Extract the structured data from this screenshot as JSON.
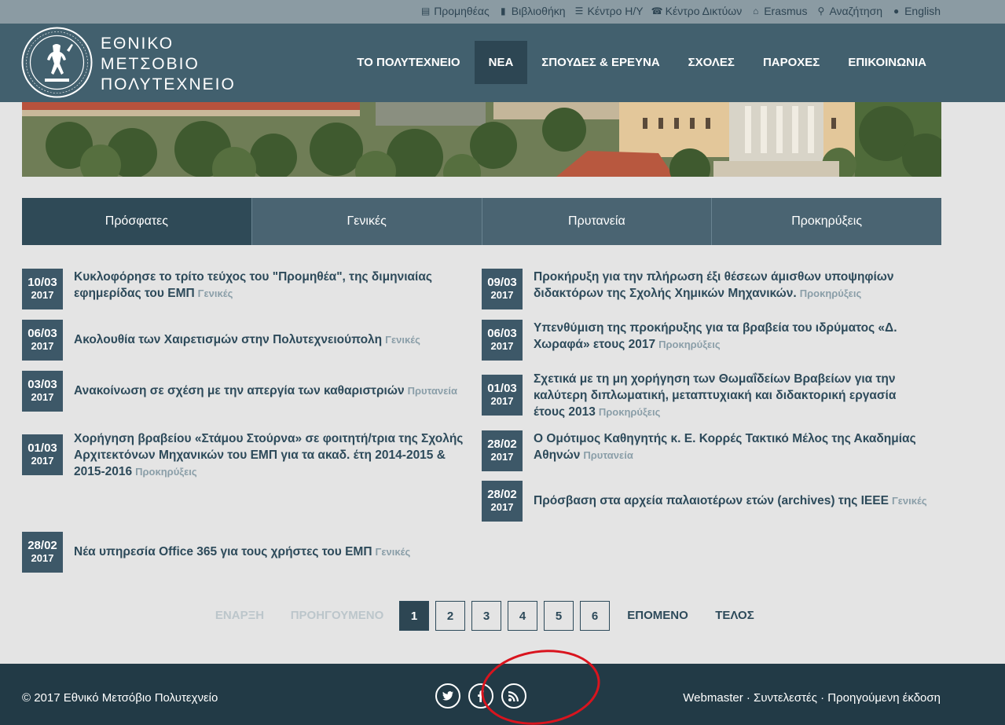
{
  "utility": {
    "items": [
      {
        "label": "Προμηθέας",
        "icon": "newspaper-icon",
        "glyph": "▤"
      },
      {
        "label": "Βιβλιοθήκη",
        "icon": "book-icon",
        "glyph": "▮"
      },
      {
        "label": "Κέντρο Η/Υ",
        "icon": "server-icon",
        "glyph": "☰"
      },
      {
        "label": "Κέντρο Δικτύων",
        "icon": "phone-icon",
        "glyph": "☎"
      },
      {
        "label": "Erasmus",
        "icon": "institution-icon",
        "glyph": "⌂"
      },
      {
        "label": "Αναζήτηση",
        "icon": "search-icon",
        "glyph": "⚲"
      },
      {
        "label": "English",
        "icon": "globe-icon",
        "glyph": "●"
      }
    ]
  },
  "brand": {
    "line1": "ΕΘΝΙΚΟ",
    "line2": "ΜΕΤΣΟΒΙΟ",
    "line3": "ΠΟΛΥΤΕΧΝΕΙΟ"
  },
  "nav": {
    "items": [
      {
        "label": "ΤΟ ΠΟΛΥΤΕΧΝΕΙΟ"
      },
      {
        "label": "ΝΕΑ"
      },
      {
        "label": "ΣΠΟΥΔΕΣ & ΕΡΕΥΝΑ"
      },
      {
        "label": "ΣΧΟΛΕΣ"
      },
      {
        "label": "ΠΑΡΟΧΕΣ"
      },
      {
        "label": "ΕΠΙΚΟΙΝΩΝΙΑ"
      }
    ],
    "active": "ΝΕΑ"
  },
  "tabs": {
    "items": [
      "Πρόσφατες",
      "Γενικές",
      "Πρυτανεία",
      "Προκηρύξεις"
    ],
    "active": "Πρόσφατες"
  },
  "news": {
    "left": [
      {
        "day": "10/03",
        "year": "2017",
        "title": "Κυκλοφόρησε το τρίτο τεύχος του \"Προμηθέα\", της διμηνιαίας εφημερίδας του ΕΜΠ",
        "category": "Γενικές"
      },
      {
        "day": "06/03",
        "year": "2017",
        "title": "Ακολουθία των Χαιρετισμών στην Πολυτεχνειούπολη",
        "category": "Γενικές"
      },
      {
        "day": "03/03",
        "year": "2017",
        "title": "Ανακοίνωση σε σχέση με την απεργία των καθαριστριών",
        "category": "Πρυτανεία"
      },
      {
        "day": "01/03",
        "year": "2017",
        "title": "Χορήγηση βραβείου «Στάμου Στούρνα» σε φοιτητή/τρια της Σχολής Αρχιτεκτόνων Μηχανικών του ΕΜΠ για τα ακαδ. έτη 2014-2015 & 2015-2016",
        "category": "Προκηρύξεις"
      },
      {
        "day": "28/02",
        "year": "2017",
        "title": "Νέα υπηρεσία Office 365 για τους χρήστες του ΕΜΠ",
        "category": "Γενικές"
      }
    ],
    "right": [
      {
        "day": "09/03",
        "year": "2017",
        "title": "Προκήρυξη για την πλήρωση έξι θέσεων άμισθων υποψηφίων διδακτόρων της Σχολής Χημικών Μηχανικών.",
        "category": "Προκηρύξεις"
      },
      {
        "day": "06/03",
        "year": "2017",
        "title": "Υπενθύμιση της προκήρυξης για τα βραβεία του ιδρύματος «Δ. Χωραφά» ετους 2017",
        "category": "Προκηρύξεις"
      },
      {
        "day": "01/03",
        "year": "2017",
        "title": "Σχετικά με τη μη χορήγηση των Θωμαΐδείων Βραβείων για την καλύτερη διπλωματική, μεταπτυχιακή και διδακτορική εργασία έτους 2013",
        "category": "Προκηρύξεις"
      },
      {
        "day": "28/02",
        "year": "2017",
        "title": "Ο Ομότιμος Καθηγητής κ. Ε. Κορρές Τακτικό Μέλος της Ακαδημίας Αθηνών",
        "category": "Πρυτανεία"
      },
      {
        "day": "28/02",
        "year": "2017",
        "title": "Πρόσβαση στα αρχεία παλαιοτέρων ετών (archives) της IEEE",
        "category": "Γενικές"
      }
    ]
  },
  "pager": {
    "first": "ΕΝΑΡΞΗ",
    "prev": "ΠΡΟΗΓΟΥΜΕΝΟ",
    "pages": [
      "1",
      "2",
      "3",
      "4",
      "5",
      "6"
    ],
    "current": "1",
    "next": "ΕΠΟΜΕΝΟ",
    "last": "ΤΕΛΟΣ"
  },
  "footer": {
    "copyright": "© 2017 Εθνικό Μετσόβιο Πολυτεχνείο",
    "links": [
      "Webmaster",
      "Συντελεστές",
      "Προηγούμενη έκδοση"
    ],
    "separator": " · ",
    "social": [
      "twitter-icon",
      "facebook-icon",
      "rss-icon"
    ]
  },
  "colors": {
    "header": "#42606e",
    "nav_active": "#2d4653",
    "footer": "#223a46",
    "date_badge": "#3d5868",
    "annotation": "#d9141e"
  }
}
